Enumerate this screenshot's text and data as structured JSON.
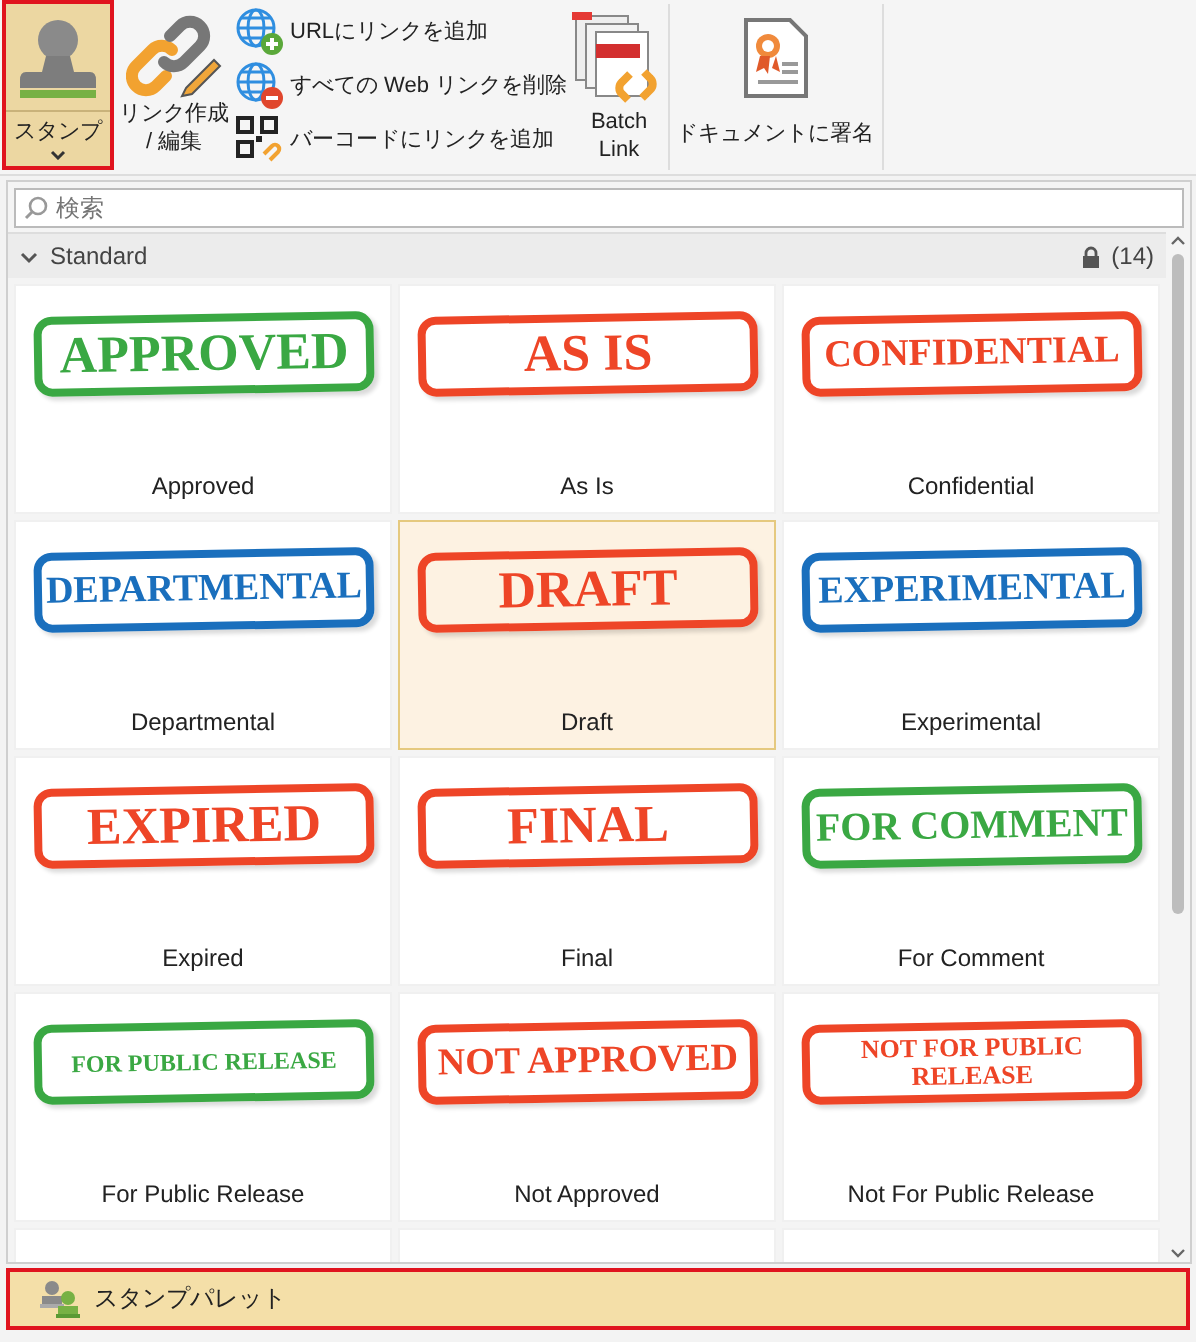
{
  "ribbon": {
    "stamp_button": {
      "label": "スタンプ",
      "highlighted": true
    },
    "link_button": {
      "label": "リンク作成\n/ 編集"
    },
    "small_buttons": [
      {
        "label": "URLにリンクを追加"
      },
      {
        "label": "すべての Web リンクを削除"
      },
      {
        "label": "バーコードにリンクを追加"
      }
    ],
    "batch_button": {
      "label": "Batch\nLink"
    },
    "sign_button": {
      "label": "ドキュメントに署名"
    }
  },
  "panel": {
    "search": {
      "placeholder": "検索"
    },
    "group": {
      "title": "Standard",
      "expanded": true,
      "locked": true,
      "count": "(14)"
    },
    "stamps": [
      {
        "stamp_text": "APPROVED",
        "label": "Approved",
        "color": "#3aa843",
        "selected": false
      },
      {
        "stamp_text": "AS IS",
        "label": "As Is",
        "color": "#ee4527",
        "selected": false
      },
      {
        "stamp_text": "CONFIDENTIAL",
        "label": "Confidential",
        "color": "#ee4527",
        "selected": false
      },
      {
        "stamp_text": "DEPARTMENTAL",
        "label": "Departmental",
        "color": "#1a6fbd",
        "selected": false
      },
      {
        "stamp_text": "DRAFT",
        "label": "Draft",
        "color": "#ee4527",
        "selected": true
      },
      {
        "stamp_text": "EXPERIMENTAL",
        "label": "Experimental",
        "color": "#1a6fbd",
        "selected": false
      },
      {
        "stamp_text": "EXPIRED",
        "label": "Expired",
        "color": "#ee4527",
        "selected": false
      },
      {
        "stamp_text": "FINAL",
        "label": "Final",
        "color": "#ee4527",
        "selected": false
      },
      {
        "stamp_text": "FOR COMMENT",
        "label": "For Comment",
        "color": "#3aa843",
        "selected": false
      },
      {
        "stamp_text": "FOR PUBLIC RELEASE",
        "label": "For Public Release",
        "color": "#3aa843",
        "selected": false
      },
      {
        "stamp_text": "NOT APPROVED",
        "label": "Not Approved",
        "color": "#ee4527",
        "selected": false
      },
      {
        "stamp_text": "NOT FOR PUBLIC\nRELEASE",
        "label": "Not For Public Release",
        "color": "#ee4527",
        "selected": false
      }
    ]
  },
  "palette_bar": {
    "label": "スタンプパレット",
    "highlighted": true
  }
}
